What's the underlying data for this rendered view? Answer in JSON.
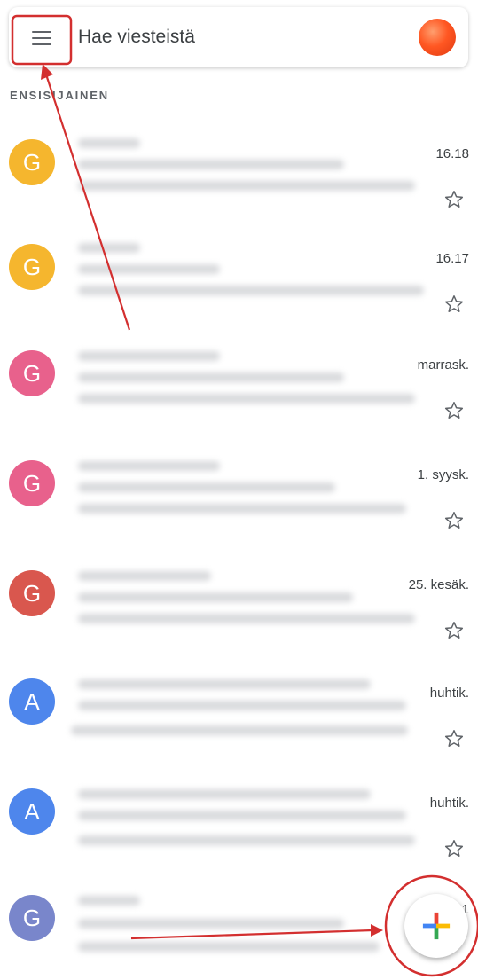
{
  "search": {
    "placeholder": "Hae viesteistä"
  },
  "section": {
    "label": "ENSISIJAINEN"
  },
  "colors": {
    "yellow": "#f5b62e",
    "pink": "#e8618c",
    "red": "#d9574e",
    "blue": "#4e86ec",
    "indigo": "#7986cb",
    "annotation_red": "#d32f2f"
  },
  "mails": [
    {
      "initial": "G",
      "date": "16.18",
      "avatar_color": "yellow"
    },
    {
      "initial": "G",
      "date": "16.17",
      "avatar_color": "yellow"
    },
    {
      "initial": "G",
      "date": "marrask.",
      "avatar_color": "pink"
    },
    {
      "initial": "G",
      "date": "1. syysk.",
      "avatar_color": "pink"
    },
    {
      "initial": "G",
      "date": "25. kesäk.",
      "avatar_color": "red"
    },
    {
      "initial": "A",
      "date": "huhtik.",
      "avatar_color": "blue"
    },
    {
      "initial": "A",
      "date": "huhtik.",
      "avatar_color": "blue"
    },
    {
      "initial": "G",
      "date": "21",
      "avatar_color": "indigo"
    }
  ],
  "icons": {
    "menu": "menu-icon",
    "star": "star-icon",
    "compose": "plus-icon"
  }
}
